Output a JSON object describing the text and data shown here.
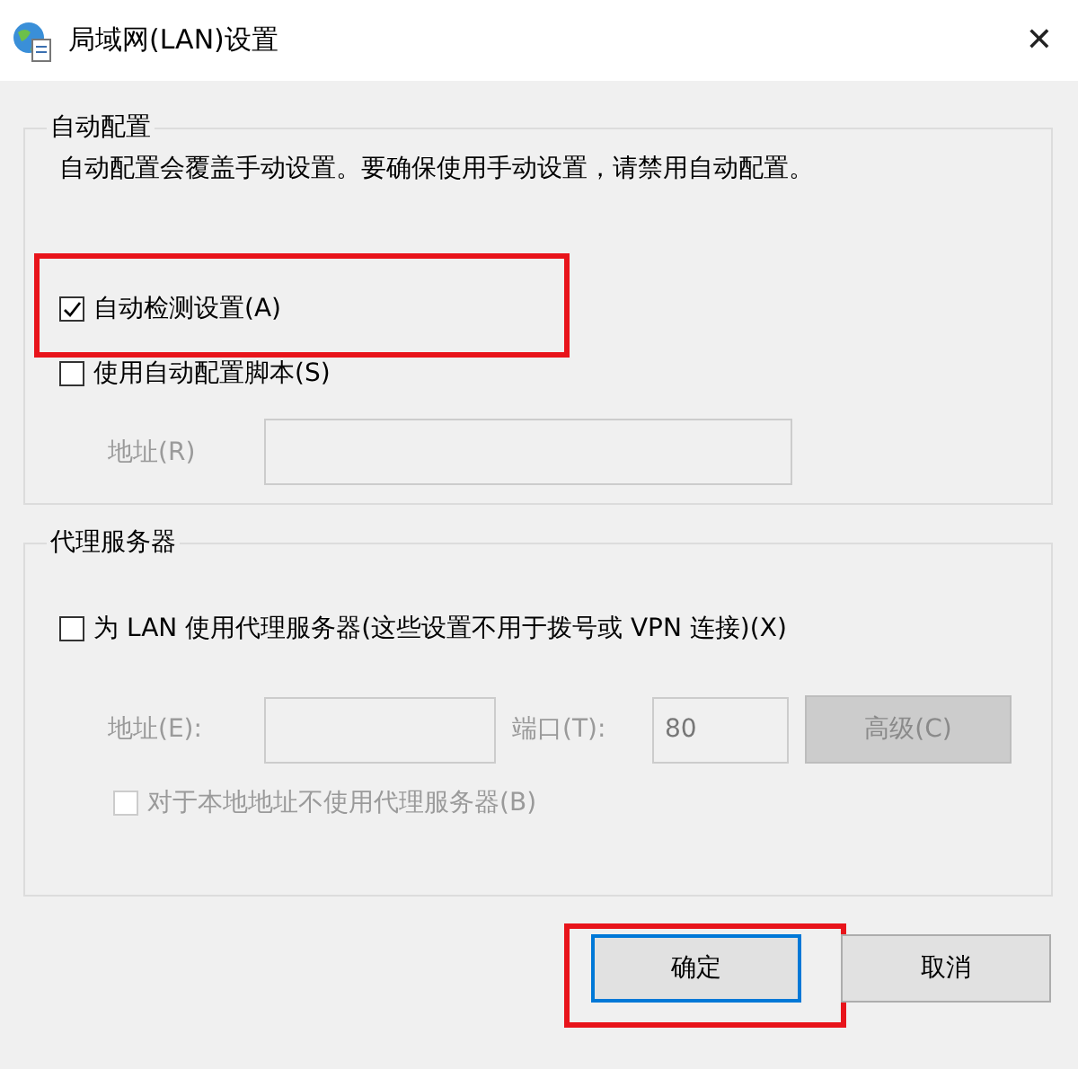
{
  "window": {
    "title": "局域网(LAN)设置",
    "close": "✕"
  },
  "auto_config": {
    "legend": "自动配置",
    "description": "自动配置会覆盖手动设置。要确保使用手动设置，请禁用自动配置。",
    "options": [
      {
        "label": "自动检测设置(A)",
        "checked": true,
        "highlighted": true
      },
      {
        "label": "使用自动配置脚本(S)",
        "checked": false,
        "highlighted": false
      }
    ],
    "address": {
      "label": "地址(R)",
      "disabled": true
    }
  },
  "proxy": {
    "legend": "代理服务器",
    "use_proxy": {
      "label": "为 LAN 使用代理服务器(这些设置不用于拨号或 VPN 连接)(X)",
      "checked": false
    },
    "address": {
      "label": "地址(E):",
      "disabled": true
    },
    "port": {
      "label": "端口(T):",
      "value": "80",
      "disabled": true
    },
    "advanced": {
      "label": "高级(C)",
      "disabled": true
    },
    "bypass_local": {
      "label": "对于本地地址不使用代理服务器(B)",
      "checked": false,
      "disabled": true
    }
  },
  "buttons": [
    {
      "label": "确定",
      "default": true,
      "highlighted": true
    },
    {
      "label": "取消",
      "default": false,
      "highlighted": false
    }
  ]
}
